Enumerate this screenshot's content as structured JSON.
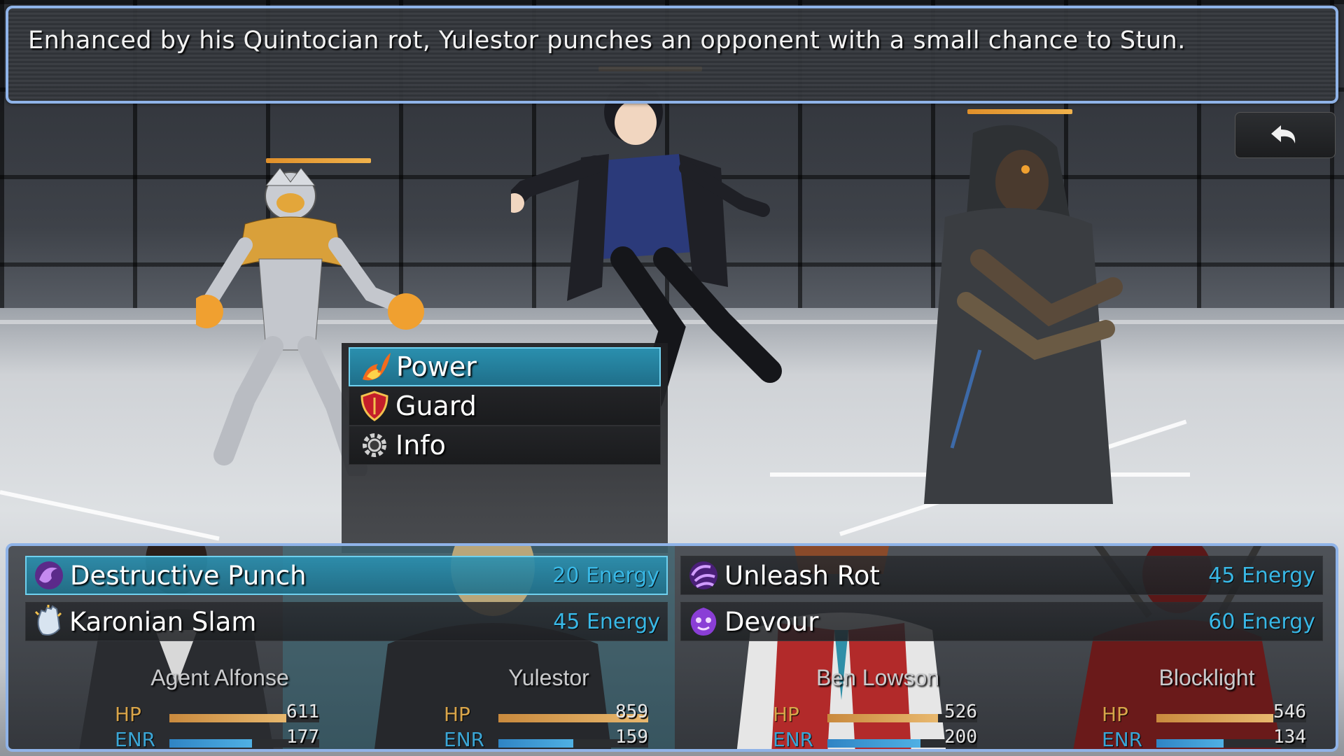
{
  "description": "Enhanced by his Quintocian rot, Yulestor punches an opponent with a small chance to Stun.",
  "back_button": {
    "icon": "undo-arrow-icon"
  },
  "command_menu": {
    "items": [
      {
        "label": "Power",
        "icon": "fire-slash-icon",
        "selected": true
      },
      {
        "label": "Guard",
        "icon": "shield-icon",
        "selected": false
      },
      {
        "label": "Info",
        "icon": "gear-icon",
        "selected": false
      }
    ]
  },
  "skills": [
    {
      "name": "Destructive Punch",
      "cost": "20 Energy",
      "icon": "purple-swirl-icon",
      "selected": true
    },
    {
      "name": "Unleash Rot",
      "cost": "45 Energy",
      "icon": "purple-vortex-icon",
      "selected": false
    },
    {
      "name": "Karonian Slam",
      "cost": "45 Energy",
      "icon": "fist-icon",
      "selected": false
    },
    {
      "name": "Devour",
      "cost": "60 Energy",
      "icon": "purple-face-icon",
      "selected": false
    }
  ],
  "party": [
    {
      "name": "Agent Alfonse",
      "hp_label": "HP",
      "hp": "611",
      "enr_label": "ENR",
      "enr": "177",
      "hp_fill": 0.78,
      "enr_fill": 0.55
    },
    {
      "name": "Yulestor",
      "hp_label": "HP",
      "hp": "859",
      "enr_label": "ENR",
      "enr": "159",
      "hp_fill": 1.0,
      "enr_fill": 0.5
    },
    {
      "name": "Ben Lowson",
      "hp_label": "HP",
      "hp": "526",
      "enr_label": "ENR",
      "enr": "200",
      "hp_fill": 0.74,
      "enr_fill": 0.62
    },
    {
      "name": "Blocklight",
      "hp_label": "HP",
      "hp": "546",
      "enr_label": "ENR",
      "enr": "134",
      "hp_fill": 0.78,
      "enr_fill": 0.45
    }
  ],
  "colors": {
    "panel_border": "#8fb3e8",
    "selected": "#2a8fae",
    "energy_text": "#39b8e6",
    "hp_label": "#d9a54a",
    "enr_label": "#3ba6d6",
    "enemy_hp": "#e0902a"
  }
}
